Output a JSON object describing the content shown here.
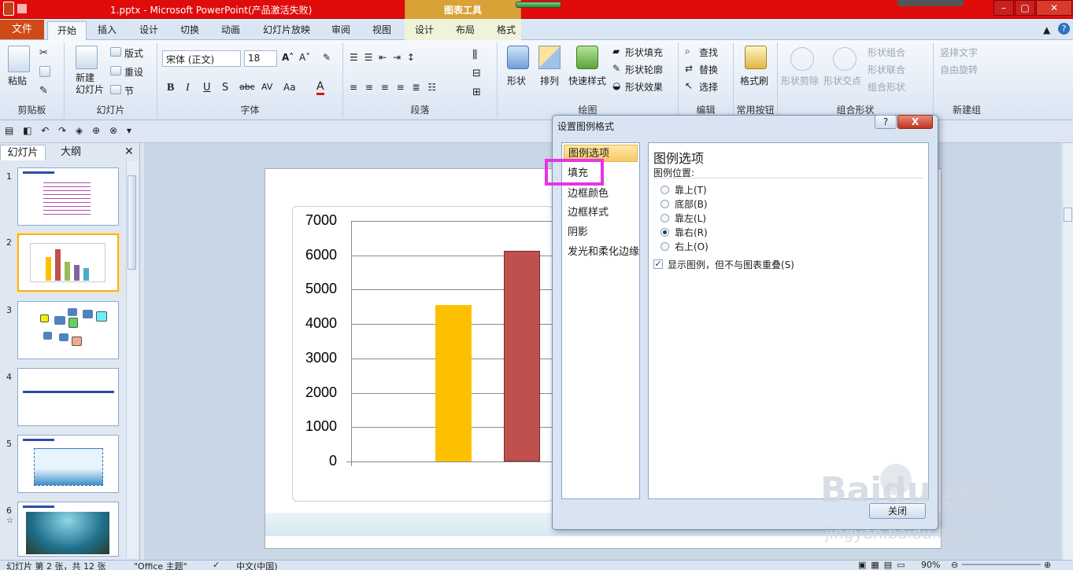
{
  "window": {
    "title": "1.pptx - Microsoft PowerPoint(产品激活失败)",
    "context_group": "图表工具"
  },
  "tabs": {
    "file": "文件",
    "items": [
      "开始",
      "插入",
      "设计",
      "切换",
      "动画",
      "幻灯片放映",
      "审阅",
      "视图"
    ],
    "context_items": [
      "设计",
      "布局",
      "格式"
    ]
  },
  "ribbon": {
    "clipboard": {
      "paste": "粘贴",
      "label": "剪贴板"
    },
    "slides": {
      "new_slide": "新建\n幻灯片",
      "layout": "版式",
      "reset": "重设",
      "section": "节",
      "label": "幻灯片"
    },
    "font": {
      "name": "宋体 (正文)",
      "size": "18",
      "label": "字体"
    },
    "paragraph": {
      "label": "段落"
    },
    "drawing": {
      "shapes": "形状",
      "arrange": "排列",
      "quick_styles": "快速样式",
      "fill": "形状填充",
      "outline": "形状轮廓",
      "effects": "形状效果",
      "label": "绘图"
    },
    "editing": {
      "find": "查找",
      "replace": "替换",
      "select": "选择",
      "label": "编辑"
    },
    "format_painter": {
      "label_btn": "格式刷",
      "label": "常用按钮"
    },
    "combine": {
      "subtract": "形状剪除",
      "intersect": "形状交点",
      "union": "形状组合",
      "merge": "形状联合",
      "group": "组合形状",
      "label": "组合形状"
    },
    "newgroup": {
      "vertical": "竖排文字",
      "rotate": "自由旋转",
      "label": "新建组"
    }
  },
  "slide_panel": {
    "tab_slides": "幻灯片",
    "tab_outline": "大纲",
    "numbers": [
      "1",
      "2",
      "3",
      "4",
      "5",
      "6"
    ]
  },
  "chart_data": {
    "type": "bar",
    "categories": [
      "",
      "",
      ""
    ],
    "values": [
      4550,
      6120,
      0
    ],
    "colors": [
      "#fdc000",
      "#c0504d"
    ],
    "yticks": [
      "7000",
      "6000",
      "5000",
      "4000",
      "3000",
      "2000",
      "1000",
      "0"
    ],
    "ylim": [
      0,
      7000
    ],
    "grid": true
  },
  "dialog": {
    "title": "设置图例格式",
    "help": "?",
    "close_x": "X",
    "nav": [
      "图例选项",
      "填充",
      "边框颜色",
      "边框样式",
      "阴影",
      "发光和柔化边缘"
    ],
    "heading": "图例选项",
    "position_label": "图例位置:",
    "positions": [
      {
        "label": "靠上(T)",
        "selected": false
      },
      {
        "label": "底部(B)",
        "selected": false
      },
      {
        "label": "靠左(L)",
        "selected": false
      },
      {
        "label": "靠右(R)",
        "selected": true
      },
      {
        "label": "右上(O)",
        "selected": false
      }
    ],
    "overlap_checkbox": "显示图例，但不与图表重叠(S)",
    "close_button": "关闭"
  },
  "status": {
    "slide_info": "幻灯片 第 2 张，共 12 张",
    "theme": "\"Office 主题\"",
    "language": "中文(中国)",
    "zoom": "90%"
  },
  "watermark": {
    "brand": "Baidu",
    "suffix": "经验",
    "url": "jingyan.baidu.com"
  }
}
